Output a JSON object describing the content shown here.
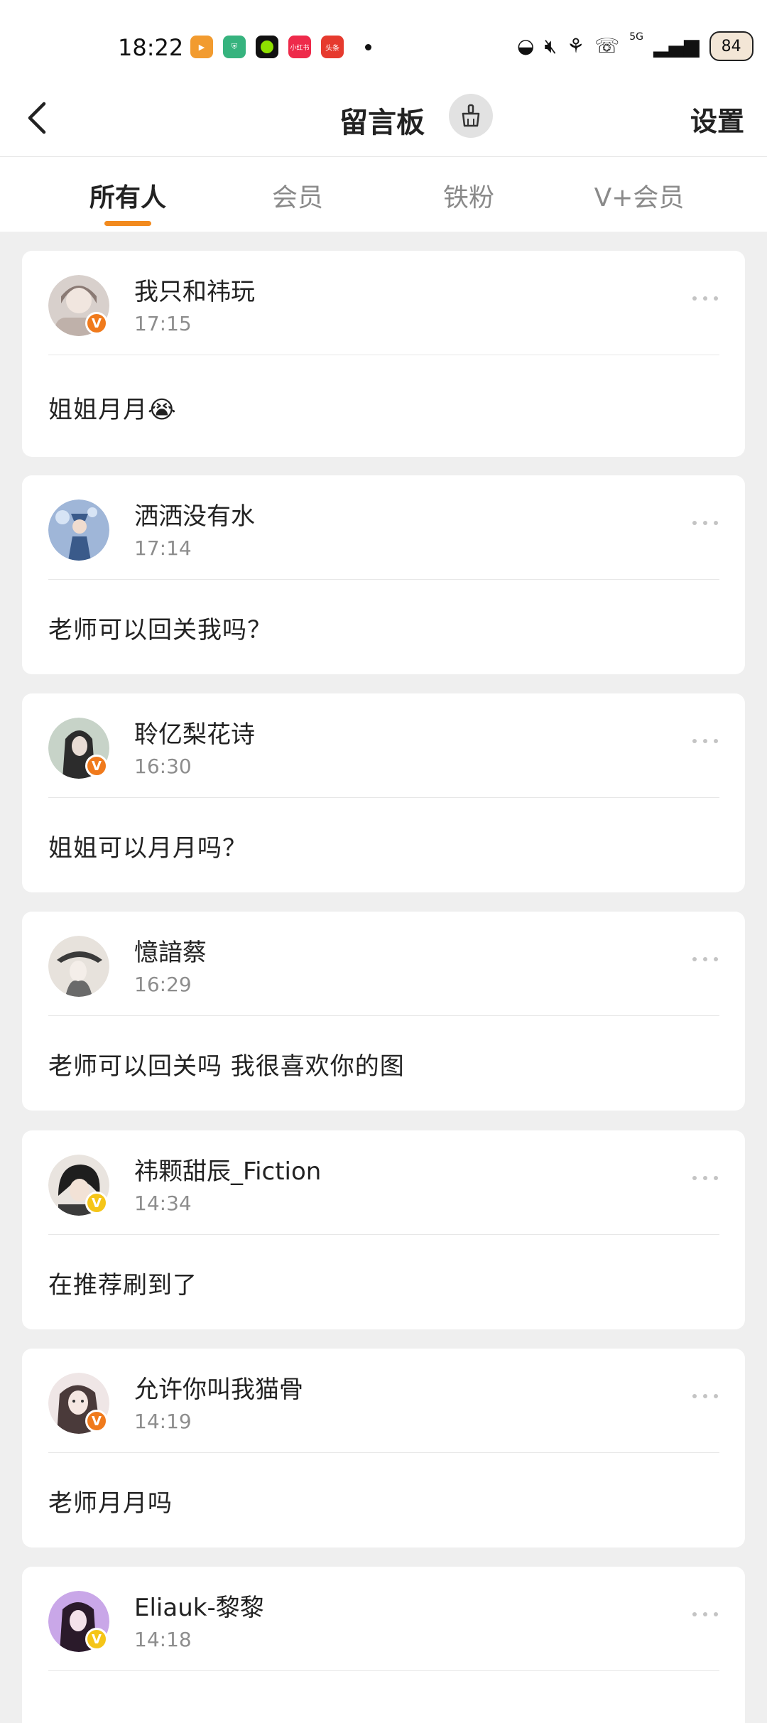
{
  "status_bar": {
    "time": "18:22",
    "network": "5G",
    "battery": "84",
    "apps": [
      {
        "name": "video-app-icon",
        "color": "#f29b2f",
        "label": ""
      },
      {
        "name": "shield-app-icon",
        "color": "#36b37e",
        "label": ""
      },
      {
        "name": "green-dot-app-icon",
        "color": "#111111",
        "label": ""
      },
      {
        "name": "xiaohongshu-app-icon",
        "color": "#ee2a4a",
        "label": "小红书"
      },
      {
        "name": "toutiao-app-icon",
        "color": "#e63a2e",
        "label": "头条"
      }
    ]
  },
  "header": {
    "title": "留言板",
    "settings_label": "设置"
  },
  "tabs": [
    {
      "label": "所有人",
      "active": true
    },
    {
      "label": "会员",
      "active": false
    },
    {
      "label": "铁粉",
      "active": false
    },
    {
      "label": "V+会员",
      "active": false
    }
  ],
  "colors": {
    "accent": "#f28a1e",
    "badge_orange": "#f07a1c",
    "badge_yellow": "#f5c518"
  },
  "posts": [
    {
      "username": "我只和祎玩",
      "time": "17:15",
      "message": "姐姐月月😭",
      "badge": "V",
      "badge_color": "#f07a1c",
      "avatar_colors": [
        "#d8d0cc",
        "#8a7a74"
      ]
    },
    {
      "username": "洒洒没有水",
      "time": "17:14",
      "message": "老师可以回关我吗？",
      "badge": "",
      "badge_color": "",
      "avatar_colors": [
        "#9fb6d8",
        "#3a5a8a"
      ]
    },
    {
      "username": "聆亿梨花诗",
      "time": "16:30",
      "message": "姐姐可以月月吗？",
      "badge": "V",
      "badge_color": "#f07a1c",
      "avatar_colors": [
        "#c7d3c8",
        "#2c2c2c"
      ]
    },
    {
      "username": "憶諳蔡",
      "time": "16:29",
      "message": "老师可以回关吗 我很喜欢你的图",
      "badge": "",
      "badge_color": "",
      "avatar_colors": [
        "#e7e2dc",
        "#3a3a3a"
      ]
    },
    {
      "username": "祎颗甜辰_Fiction",
      "time": "14:34",
      "message": "在推荐刷到了",
      "badge": "V",
      "badge_color": "#f5c518",
      "avatar_colors": [
        "#e9e4df",
        "#1e1e1e"
      ]
    },
    {
      "username": "允许你叫我猫骨",
      "time": "14:19",
      "message": "老师月月吗",
      "badge": "V",
      "badge_color": "#f07a1c",
      "avatar_colors": [
        "#efe6e6",
        "#4a3a3a"
      ]
    },
    {
      "username": "Eliauk-黎黎",
      "time": "14:18",
      "message": "",
      "badge": "V",
      "badge_color": "#f5c518",
      "avatar_colors": [
        "#c9a7e8",
        "#2a1a2a"
      ]
    }
  ]
}
